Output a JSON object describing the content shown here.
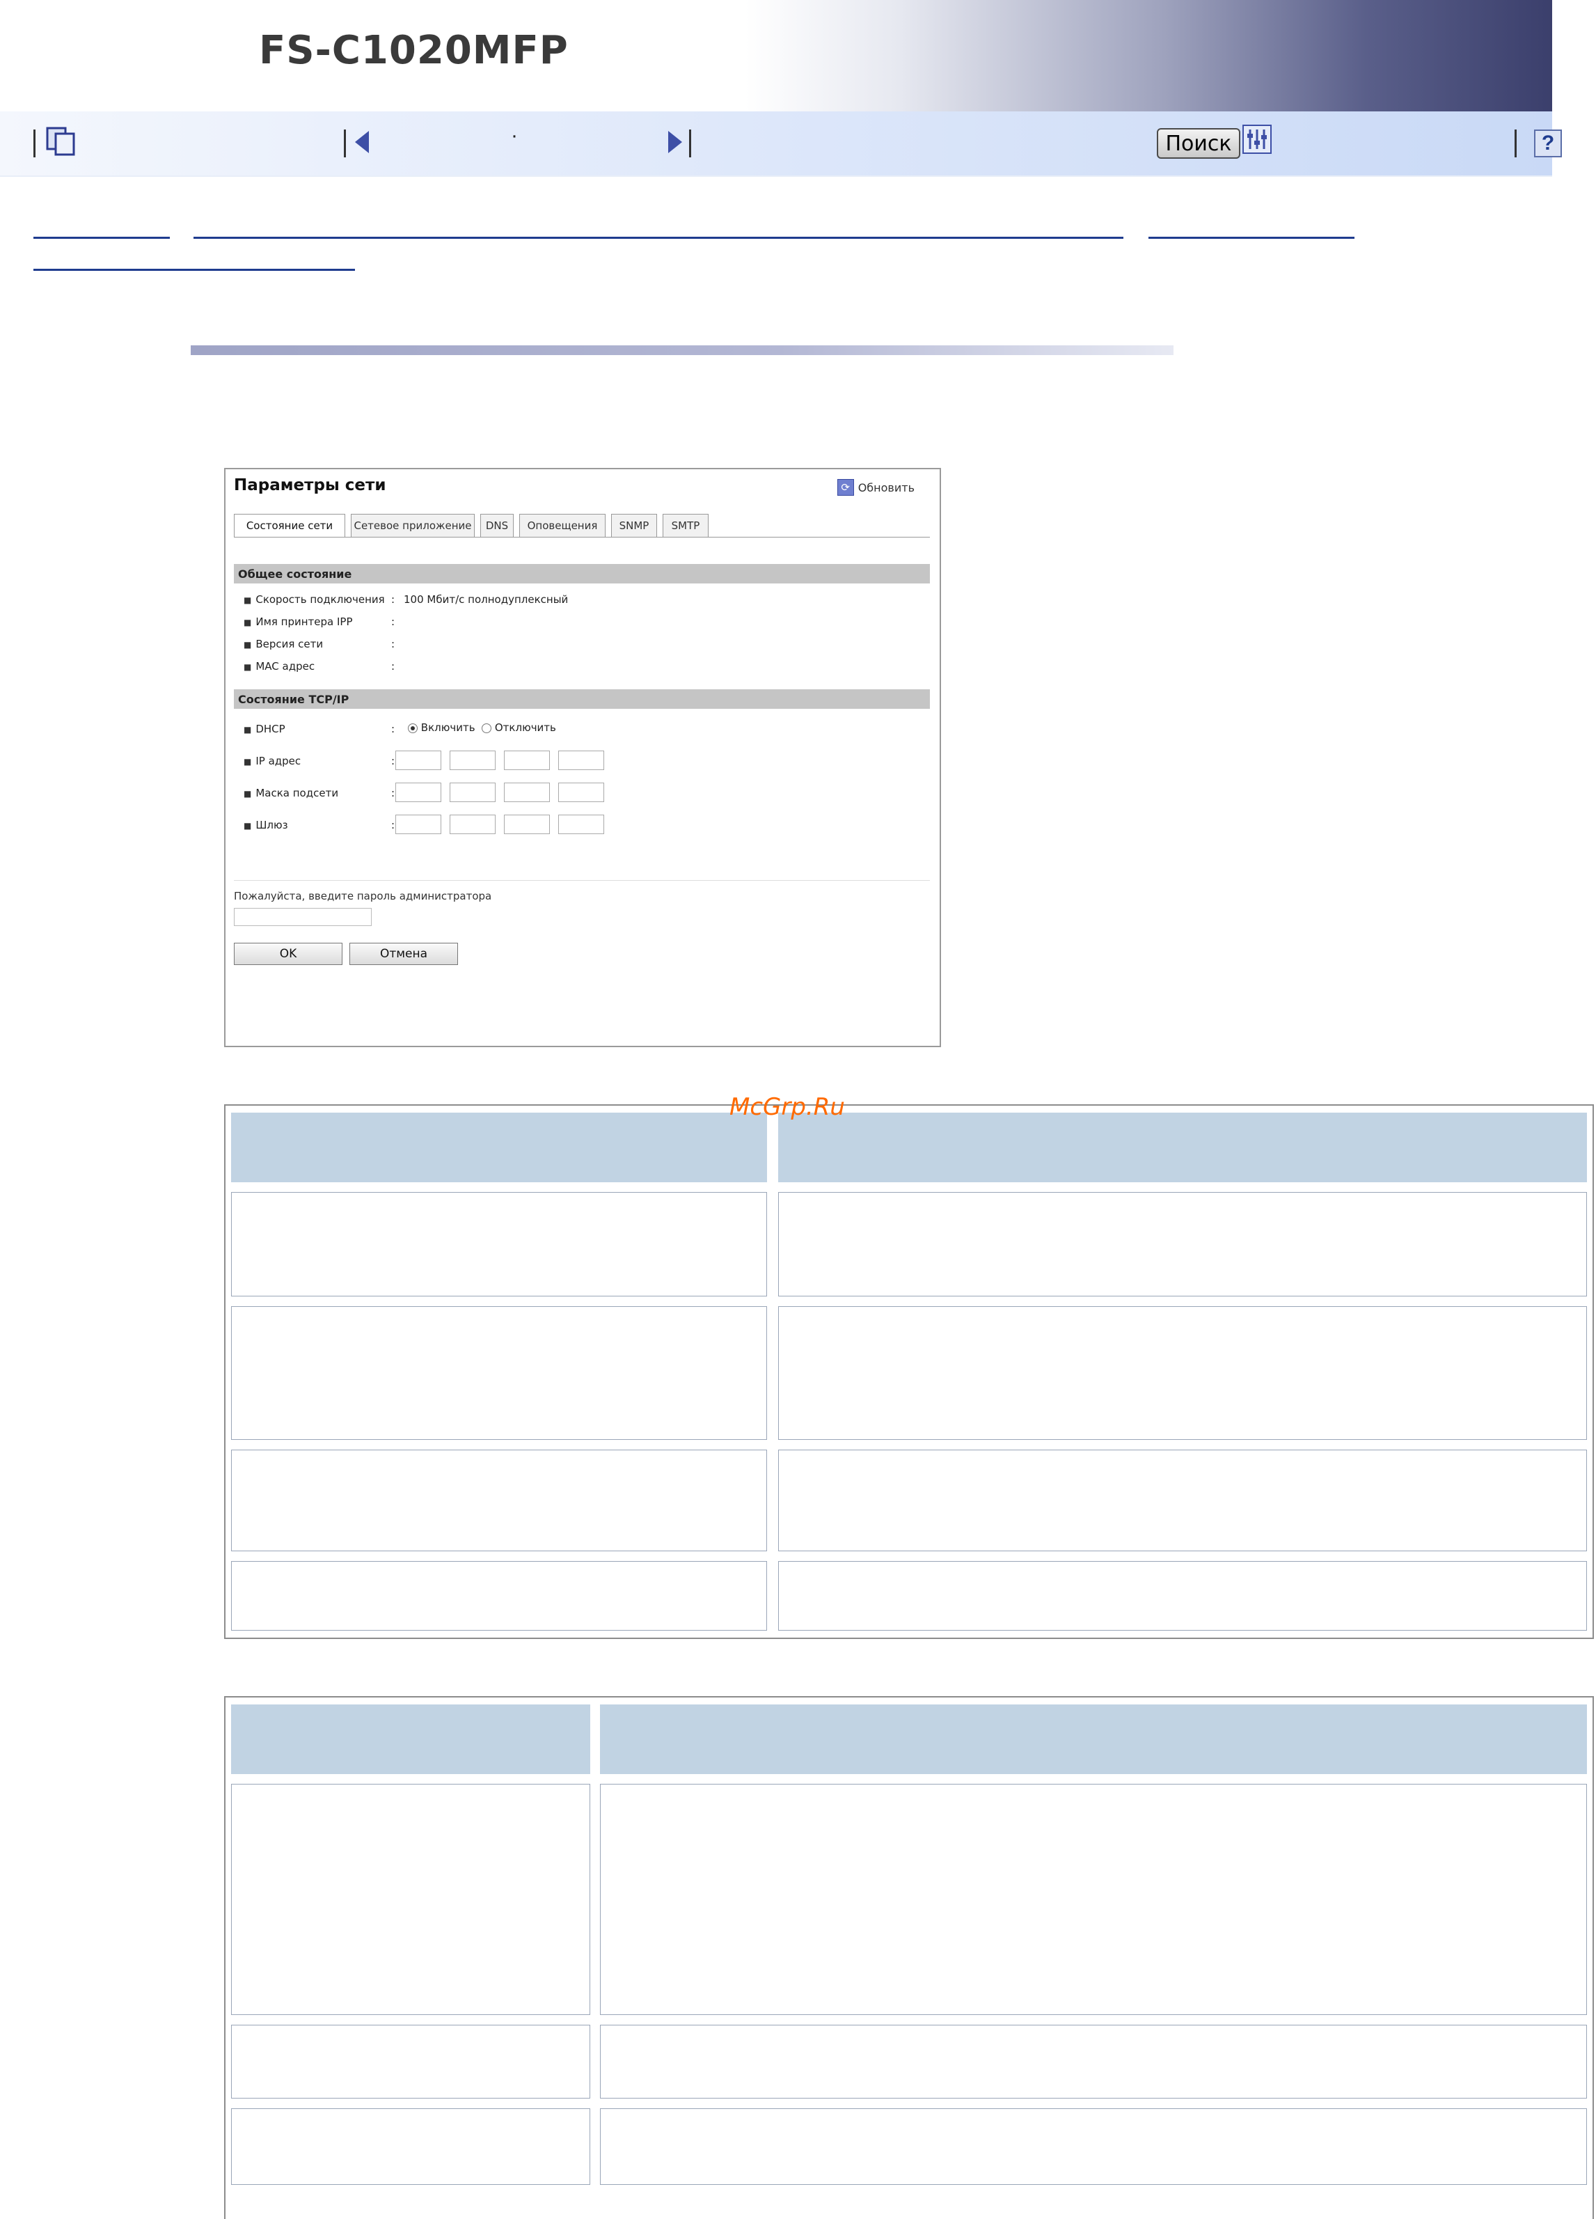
{
  "header": {
    "product": "FS-C1020MFP"
  },
  "toolbar": {
    "contents_icon": "book-pages-icon",
    "prev_icon": "prev-page-icon",
    "dot": "·",
    "next_icon": "next-page-icon",
    "search_label": "Поиск",
    "settings_icon": "settings-icon",
    "help_label": "?"
  },
  "watermark": "McGrp.Ru",
  "panel": {
    "title": "Параметры сети",
    "refresh_label": "Обновить",
    "tabs": [
      "Состояние сети",
      "Сетевое приложение",
      "DNS",
      "Оповещения",
      "SNMP",
      "SMTP"
    ],
    "general_section": "Общее состояние",
    "general_rows": [
      {
        "label": "Скорость подключения",
        "value": "100 Мбит/с полнодуплексный"
      },
      {
        "label": "Имя принтера IPP",
        "value": ""
      },
      {
        "label": "Версия сети",
        "value": ""
      },
      {
        "label": "MAC адрес",
        "value": ""
      }
    ],
    "tcpip_section": "Состояние TCP/IP",
    "dhcp": {
      "label": "DHCP",
      "enable": "Включить",
      "disable": "Отключить",
      "selected": "enable"
    },
    "ip_rows": [
      "IP адрес",
      "Маска подсети",
      "Шлюз"
    ],
    "colon": ":",
    "password_prompt": "Пожалуйста, введите пароль администратора",
    "ok_label": "OK",
    "cancel_label": "Отмена"
  }
}
